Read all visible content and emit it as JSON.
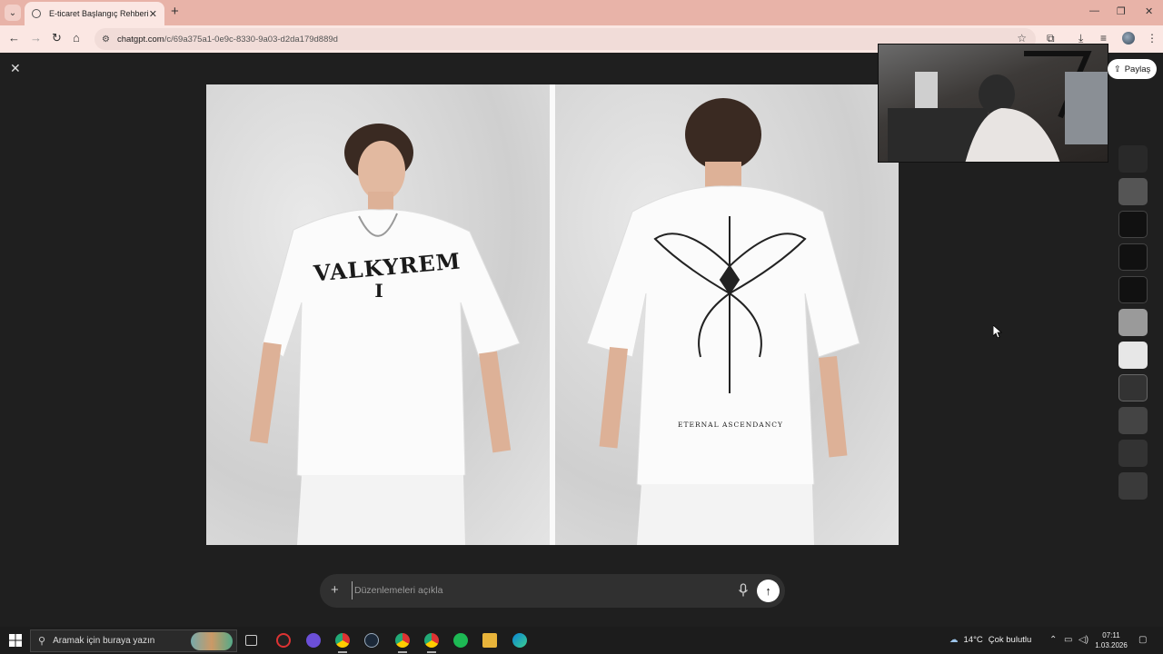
{
  "browser": {
    "tab_title": "E-ticaret Başlangıç Rehberi",
    "tab_close": "✕",
    "new_tab": "+",
    "url_host": "chatgpt.com",
    "url_path": "/c/69a375a1-0e9c-8330-9a03-d2da179d889d",
    "window_controls": [
      "—",
      "❐",
      "✕"
    ]
  },
  "viewer": {
    "close": "✕",
    "share_label": "Paylaş"
  },
  "image": {
    "front_print_title": "VALKYREM",
    "front_print_sub": "I",
    "back_print_text": "ETERNAL ASCENDANCY"
  },
  "thumbnails": {
    "count": 11,
    "active_index": 6
  },
  "composer": {
    "placeholder": "Düzenlemeleri açıkla",
    "plus": "+",
    "send": "↑"
  },
  "taskbar": {
    "search_placeholder": "Aramak için buraya yazın",
    "weather_temp": "14°C",
    "weather_desc": "Çok bulutlu",
    "time": "07:11",
    "date": "1.03.2026"
  },
  "colors": {
    "chrome_tab_bar": "#e8b3a8",
    "chrome_toolbar": "#fbe7e3",
    "viewer_bg": "#1f1f1f",
    "taskbar_bg": "#1c1c1c"
  }
}
